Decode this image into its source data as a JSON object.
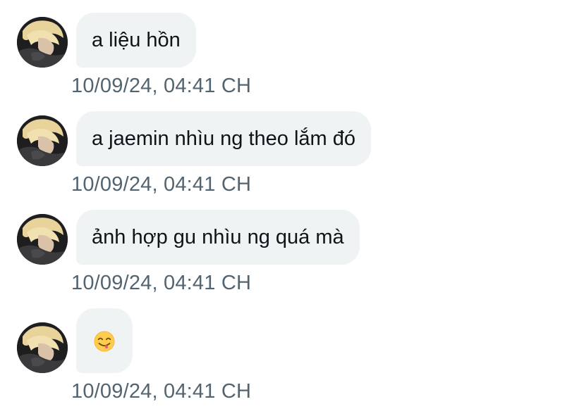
{
  "messages": [
    {
      "text": "a liệu hồn",
      "timestamp": "10/09/24, 04:41 CH"
    },
    {
      "text": "a jaemin nhìu ng theo lắm đó",
      "timestamp": "10/09/24, 04:41 CH"
    },
    {
      "text": "ảnh hợp gu nhìu ng quá mà",
      "timestamp": "10/09/24, 04:41 CH"
    },
    {
      "emoji": "face-savoring-food-emoji",
      "timestamp": "10/09/24, 04:41 CH"
    }
  ],
  "colors": {
    "bubble_bg": "#eff3f4",
    "text": "#0f1419",
    "timestamp": "#536471"
  },
  "icons": {
    "avatar": "sender-avatar-photo"
  }
}
